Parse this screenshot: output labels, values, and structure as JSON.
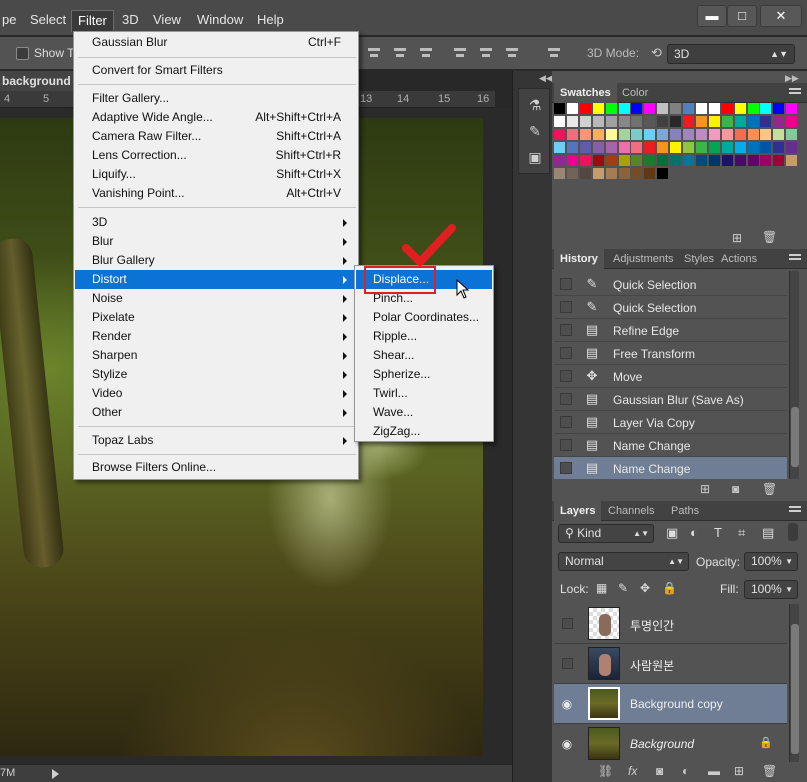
{
  "menubar": {
    "items": [
      "pe",
      "Select",
      "Filter",
      "3D",
      "View",
      "Window",
      "Help"
    ],
    "active": "Filter"
  },
  "window_controls": {
    "minimize": "▬",
    "maximize": "□",
    "close": "✕"
  },
  "options_bar": {
    "show_transform_label": "Show T",
    "mode3d_label": "3D Mode:",
    "mode3d_value": "3D"
  },
  "document": {
    "tab_title": "background copy",
    "ruler_numbers": [
      "4",
      "5",
      "13",
      "14",
      "15",
      "16"
    ],
    "zoom": "7M"
  },
  "filter_menu": {
    "items": [
      {
        "label": "Gaussian Blur",
        "shortcut": "Ctrl+F"
      },
      {
        "label": "Convert for Smart Filters",
        "shortcut": ""
      },
      {
        "label": "Filter Gallery...",
        "shortcut": ""
      },
      {
        "label": "Adaptive Wide Angle...",
        "shortcut": "Alt+Shift+Ctrl+A"
      },
      {
        "label": "Camera Raw Filter...",
        "shortcut": "Shift+Ctrl+A"
      },
      {
        "label": "Lens Correction...",
        "shortcut": "Shift+Ctrl+R"
      },
      {
        "label": "Liquify...",
        "shortcut": "Shift+Ctrl+X"
      },
      {
        "label": "Vanishing Point...",
        "shortcut": "Alt+Ctrl+V"
      },
      {
        "label": "3D",
        "shortcut": ""
      },
      {
        "label": "Blur",
        "shortcut": ""
      },
      {
        "label": "Blur Gallery",
        "shortcut": ""
      },
      {
        "label": "Distort",
        "shortcut": ""
      },
      {
        "label": "Noise",
        "shortcut": ""
      },
      {
        "label": "Pixelate",
        "shortcut": ""
      },
      {
        "label": "Render",
        "shortcut": ""
      },
      {
        "label": "Sharpen",
        "shortcut": ""
      },
      {
        "label": "Stylize",
        "shortcut": ""
      },
      {
        "label": "Video",
        "shortcut": ""
      },
      {
        "label": "Other",
        "shortcut": ""
      },
      {
        "label": "Topaz Labs",
        "shortcut": ""
      },
      {
        "label": "Browse Filters Online...",
        "shortcut": ""
      }
    ],
    "highlighted": "Distort"
  },
  "distort_submenu": {
    "items": [
      "Displace...",
      "Pinch...",
      "Polar Coordinates...",
      "Ripple...",
      "Shear...",
      "Spherize...",
      "Twirl...",
      "Wave...",
      "ZigZag..."
    ],
    "highlighted": "Displace..."
  },
  "swatches_panel": {
    "tabs": [
      "Swatches",
      "Color"
    ],
    "colors": [
      "#000000",
      "#ffffff",
      "#ff0000",
      "#ffff00",
      "#00ff00",
      "#00ffff",
      "#0000ff",
      "#ff00ff",
      "#c0c0c0",
      "#808080",
      "#4f81bd",
      "#ffffff",
      "#ffffff",
      "#ff0000",
      "#ffff00",
      "#00ff00",
      "#00ffff",
      "#0000ff",
      "#ff00ff",
      "#ffffff",
      "#e8e8e8",
      "#d0d0d0",
      "#b8b8b8",
      "#a0a0a0",
      "#888888",
      "#707070",
      "#585858",
      "#404040",
      "#282828",
      "#ed1c24",
      "#f7941d",
      "#fff200",
      "#39b54a",
      "#00a99d",
      "#0072bc",
      "#2e3192",
      "#92278f",
      "#ec008c",
      "#ed145b",
      "#f26d7d",
      "#f69679",
      "#fbaf5d",
      "#fff799",
      "#a3d39c",
      "#7accc8",
      "#6dcff6",
      "#7da7d9",
      "#8781bd",
      "#a186be",
      "#bd8cbf",
      "#f49ac1",
      "#f5989d",
      "#f26c4f",
      "#f68e56",
      "#fdc689",
      "#c4df9b",
      "#82ca9c",
      "#6ecff6",
      "#5674b9",
      "#605ca8",
      "#855fa8",
      "#a864a8",
      "#f06eaa",
      "#f26d7d",
      "#ed1c24",
      "#f7941d",
      "#fff200",
      "#8dc63f",
      "#39b54a",
      "#00a651",
      "#00a99d",
      "#00aeef",
      "#0072bc",
      "#0054a6",
      "#2e3192",
      "#662d91",
      "#92278f",
      "#ec008c",
      "#ed145b",
      "#9e0b0f",
      "#a0410d",
      "#aba000",
      "#598527",
      "#197b30",
      "#007236",
      "#00746b",
      "#0076a3",
      "#004a80",
      "#003471",
      "#1b1464",
      "#440e62",
      "#630460",
      "#9e005d",
      "#9e0039",
      "#c69c6d",
      "#998675",
      "#736357",
      "#534741",
      "#c69c6d",
      "#a67c52",
      "#8c6239",
      "#754c24",
      "#603913",
      "#000000"
    ]
  },
  "history_panel": {
    "tabs": [
      "History",
      "Adjustments",
      "Styles",
      "Actions"
    ],
    "items": [
      {
        "label": "Quick Selection",
        "icon": "brush-icon"
      },
      {
        "label": "Quick Selection",
        "icon": "brush-icon"
      },
      {
        "label": "Refine Edge",
        "icon": "document-icon"
      },
      {
        "label": "Free Transform",
        "icon": "document-icon"
      },
      {
        "label": "Move",
        "icon": "move-icon"
      },
      {
        "label": "Gaussian Blur (Save As)",
        "icon": "document-icon"
      },
      {
        "label": "Layer Via Copy",
        "icon": "document-icon"
      },
      {
        "label": "Name Change",
        "icon": "document-icon"
      },
      {
        "label": "Name Change",
        "icon": "document-icon"
      }
    ],
    "selected_index": 8
  },
  "layers_panel": {
    "tabs": [
      "Layers",
      "Channels",
      "Paths"
    ],
    "filter_kind": "Kind",
    "blend_mode": "Normal",
    "opacity_label": "Opacity:",
    "opacity_value": "100%",
    "lock_label": "Lock:",
    "fill_label": "Fill:",
    "fill_value": "100%",
    "layers": [
      {
        "name": "투명인간",
        "visible": false
      },
      {
        "name": "사람원본",
        "visible": false
      },
      {
        "name": "Background copy",
        "visible": true
      },
      {
        "name": "Background",
        "visible": true,
        "locked": true
      }
    ],
    "selected_index": 2
  }
}
